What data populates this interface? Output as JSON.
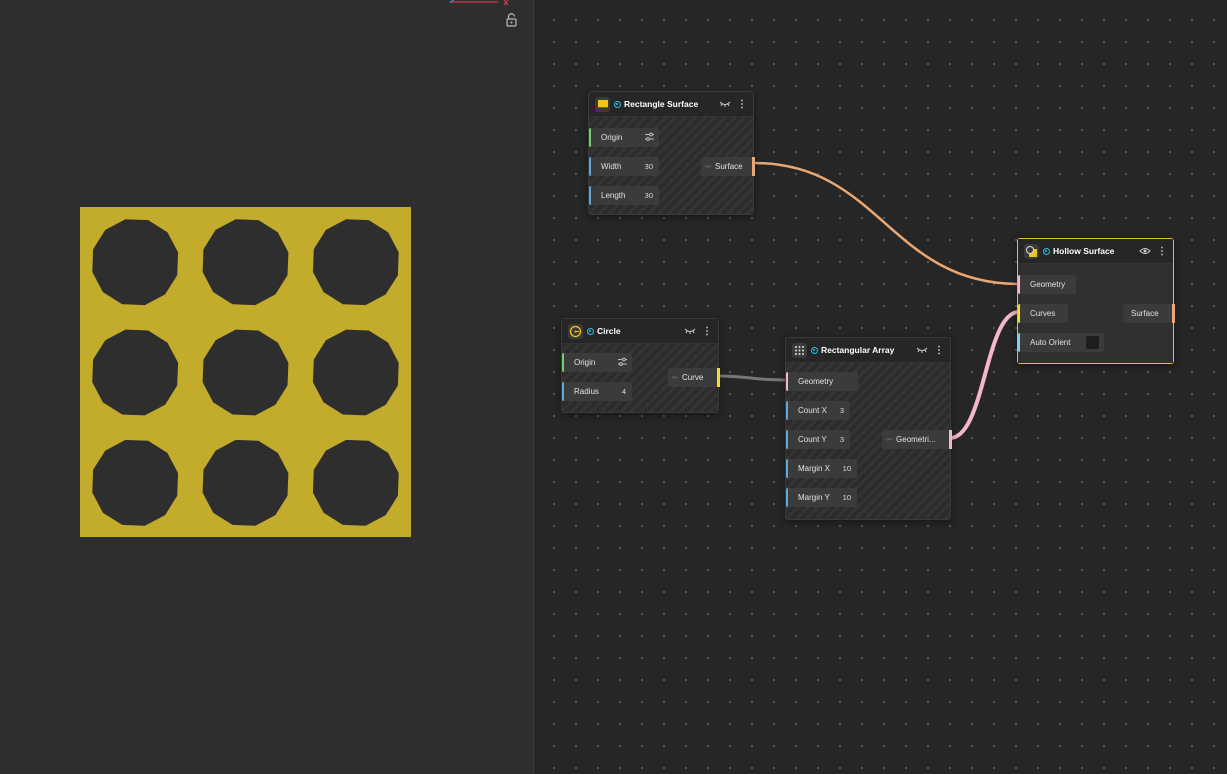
{
  "colors": {
    "shape_fill": "#c3ac2c",
    "hole_fill": "#2e2e2e",
    "wire_surface": "#e8a774",
    "wire_curve": "#777777",
    "wire_geometry": "#f4b7c8",
    "selected_border": "#e6c21d",
    "status": "#27c3e8"
  },
  "viewport": {
    "icons": [
      "axis-gizmo",
      "unlock-icon"
    ]
  },
  "nodes": {
    "rect_surface": {
      "title": "Rectangle Surface",
      "inputs": [
        {
          "label": "Origin",
          "value": ""
        },
        {
          "label": "Width",
          "value": "30"
        },
        {
          "label": "Length",
          "value": "30"
        }
      ],
      "output": "Surface"
    },
    "circle": {
      "title": "Circle",
      "inputs": [
        {
          "label": "Origin",
          "value": ""
        },
        {
          "label": "Radius",
          "value": "4"
        }
      ],
      "output": "Curve"
    },
    "rect_array": {
      "title": "Rectangular Array",
      "inputs": [
        {
          "label": "Geometry",
          "value": ""
        },
        {
          "label": "Count X",
          "value": "3"
        },
        {
          "label": "Count Y",
          "value": "3"
        },
        {
          "label": "Margin X",
          "value": "10"
        },
        {
          "label": "Margin Y",
          "value": "10"
        }
      ],
      "output": "Geometri..."
    },
    "hollow_surface": {
      "title": "Hollow Surface",
      "inputs": [
        {
          "label": "Geometry"
        },
        {
          "label": "Curves"
        },
        {
          "label": "Auto Orient"
        }
      ],
      "output": "Surface"
    }
  }
}
